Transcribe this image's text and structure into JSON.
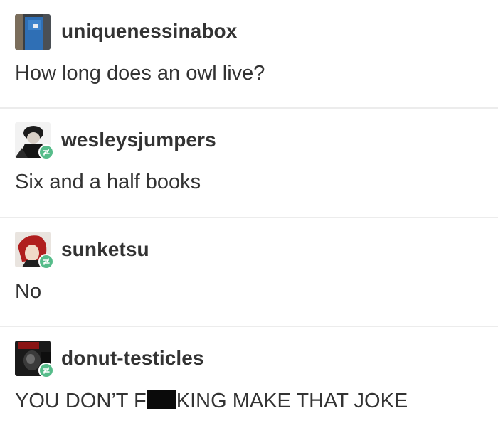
{
  "posts": [
    {
      "username": "uniquenessinabox",
      "text": "How long does an owl live?",
      "avatar_icon": "blue-door-avatar",
      "reblog": false
    },
    {
      "username": "wesleysjumpers",
      "text": "Six and a half books",
      "avatar_icon": "person-avatar",
      "reblog": true
    },
    {
      "username": "sunketsu",
      "text": "No",
      "avatar_icon": "red-hair-avatar",
      "reblog": true
    },
    {
      "username": "donut-testicles",
      "text_before": "YOU DON’T F",
      "text_after": "KING MAKE THAT JOKE",
      "avatar_icon": "dark-scene-avatar",
      "reblog": true
    }
  ],
  "colors": {
    "text": "#333333",
    "reblog_badge": "#56bc8a",
    "divider": "#ececec"
  }
}
